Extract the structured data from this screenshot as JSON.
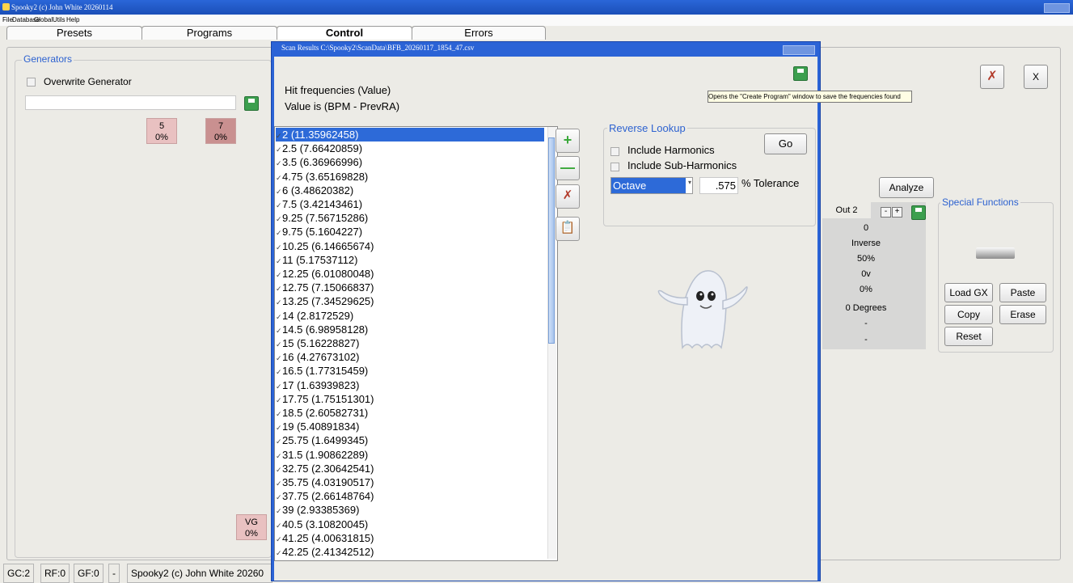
{
  "window": {
    "title": "Spooky2 (c) John White 20260114"
  },
  "menu": [
    "File",
    "Database",
    "Global",
    "Utils",
    "Help"
  ],
  "tabs": [
    "Presets",
    "Programs",
    "Control",
    "Errors"
  ],
  "generators": {
    "group_label": "Generators",
    "overwrite_label": "Overwrite Generator",
    "input_value": "",
    "boxes": [
      {
        "top": "5",
        "bottom": "0%"
      },
      {
        "top": "7",
        "bottom": "0%"
      },
      {
        "top": "VG",
        "bottom": "0%"
      }
    ]
  },
  "right_panel": {
    "close_label": "X",
    "analyze_label": "Analyze",
    "out_header": "Out 2",
    "out_minus": "-",
    "out_plus": "+",
    "out_values": [
      "0",
      "Inverse",
      "50%",
      "0v",
      "0%",
      "0 Degrees",
      "-",
      "-"
    ],
    "special_label": "Special Functions",
    "buttons": [
      "Load GX",
      "Paste",
      "Copy",
      "Erase",
      "Reset"
    ]
  },
  "status": [
    "GC:2",
    "RF:0",
    "GF:0",
    "-",
    "Spooky2 (c) John White 20260"
  ],
  "dialog": {
    "title": "Scan Results C:\\Spooky2\\ScanData\\BFB_20260117_1854_47.csv",
    "heading1": "Hit frequencies (Value)",
    "heading2": "Value is (BPM - PrevRA)",
    "tooltip": "Opens the \"Create Program\" window to save the frequencies found",
    "list": [
      "2  (11.35962458)",
      "2.5  (7.66420859)",
      "3.5  (6.36966996)",
      "4.75  (3.65169828)",
      "6  (3.48620382)",
      "7.5  (3.42143461)",
      "9.25  (7.56715286)",
      "9.75  (5.1604227)",
      "10.25  (6.14665674)",
      "11  (5.17537112)",
      "12.25  (6.01080048)",
      "12.75  (7.15066837)",
      "13.25  (7.34529625)",
      "14  (2.8172529)",
      "14.5  (6.98958128)",
      "15  (5.16228827)",
      "16  (4.27673102)",
      "16.5  (1.77315459)",
      "17  (1.63939823)",
      "17.75  (1.75151301)",
      "18.5  (2.60582731)",
      "19  (5.40891834)",
      "25.75  (1.6499345)",
      "31.5  (1.90862289)",
      "32.75  (2.30642541)",
      "35.75  (4.03190517)",
      "37.75  (2.66148764)",
      "39  (2.93385369)",
      "40.5  (3.10820045)",
      "41.25  (4.00631815)",
      "42.25  (2.41342512)"
    ],
    "reverse_lookup": {
      "label": "Reverse Lookup",
      "include_harmonics": "Include Harmonics",
      "include_subharmonics": "Include Sub-Harmonics",
      "go": "Go",
      "mode": "Octave",
      "tolerance_value": ".575",
      "tolerance_label": "% Tolerance"
    }
  }
}
